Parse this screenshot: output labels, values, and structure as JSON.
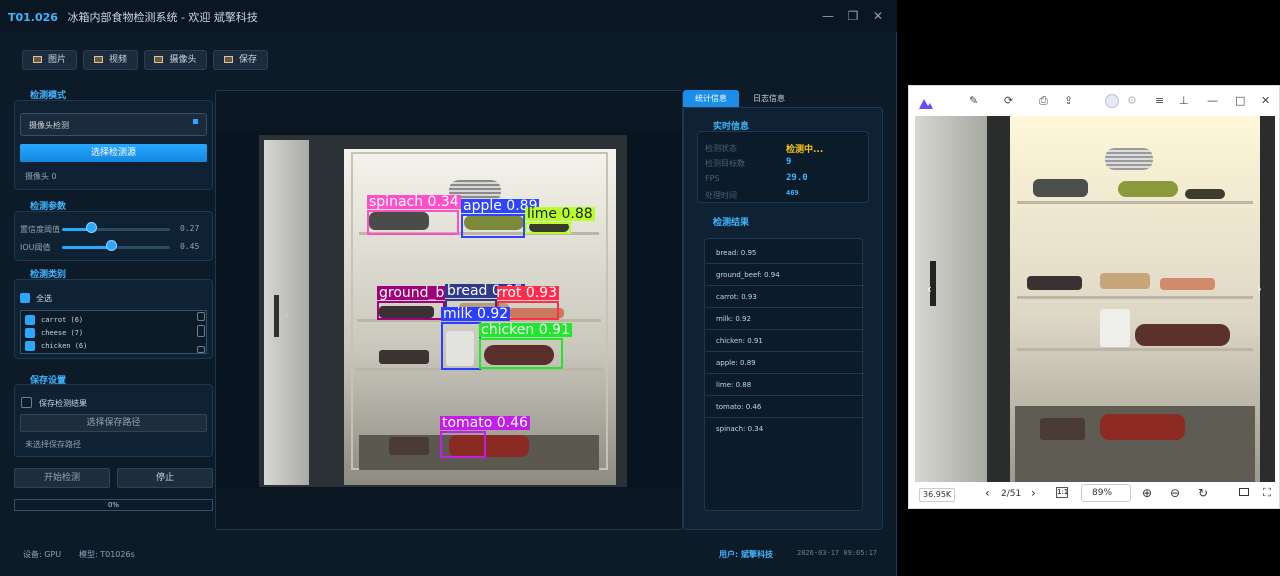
{
  "app": {
    "title_code": "T01.026",
    "title_text": "冰箱内部食物检测系统 - 欢迎 斌擎科技",
    "window_controls": [
      "—",
      "❐",
      "✕"
    ]
  },
  "toolbar": {
    "image_label": "图片",
    "video_label": "视频",
    "camera_label": "摄像头",
    "save_label": "保存"
  },
  "detect_mode": {
    "title": "检测模式",
    "selected_mode": "摄像头检测",
    "select_source_label": "选择检测源",
    "source_status": "摄像头 0"
  },
  "params": {
    "title": "检测参数",
    "conf_label": "置信度阈值",
    "conf_value": "0.27",
    "conf_fraction": 0.27,
    "iou_label": "IOU阈值",
    "iou_value": "0.45",
    "iou_fraction": 0.45
  },
  "classes": {
    "title": "检测类别",
    "select_all_label": "全选",
    "items": [
      "carrot (6)",
      "cheese (7)",
      "chicken (6)"
    ]
  },
  "save_settings": {
    "title": "保存设置",
    "save_result_label": "保存检测结果",
    "choose_path_label": "选择保存路径",
    "path_status": "未选择保存路径"
  },
  "controls": {
    "start_label": "开始检测",
    "stop_label": "停止",
    "progress_text": "0%",
    "progress_fraction": 0.0
  },
  "detections": [
    {
      "label": "spinach 0.34",
      "color": "#ff4fc8"
    },
    {
      "label": "apple 0.89",
      "color": "#2f44ff"
    },
    {
      "label": "lime 0.88",
      "color": "#b7ff2a"
    },
    {
      "label": "ground_beef 0.94",
      "color": "#a0007a"
    },
    {
      "label": "bread 0.95",
      "color": "#2e3a8a"
    },
    {
      "label": "carrot 0.93",
      "color": "#ff2d4b"
    },
    {
      "label": "milk 0.92",
      "color": "#2a3fff"
    },
    {
      "label": "chicken 0.91",
      "color": "#1ee82a"
    },
    {
      "label": "tomato 0.46",
      "color": "#c21ee8"
    }
  ],
  "right_panel": {
    "tab_stats": "统计信息",
    "tab_log": "日志信息",
    "realtime_title": "实时信息",
    "stats": [
      {
        "key": "检测状态",
        "value": "检测中...",
        "color": "#f5c518"
      },
      {
        "key": "检测目标数",
        "value": "9",
        "color": "#3fb6ff"
      },
      {
        "key": "FPS",
        "value": "29.0",
        "color": "#3fb6ff"
      },
      {
        "key": "处理时间",
        "value": "469",
        "color": "#3fb6ff"
      }
    ],
    "results_title": "检测结果",
    "results": [
      "bread: 0.95",
      "ground_beef: 0.94",
      "carrot: 0.93",
      "milk: 0.92",
      "chicken: 0.91",
      "apple: 0.89",
      "lime: 0.88",
      "tomato: 0.46",
      "spinach: 0.34"
    ]
  },
  "status_bar": {
    "device": "设备: GPU",
    "model": "模型: T01026s",
    "user_label": "用户: 斌擎科技",
    "datetime": "2026-03-17 09:05:17"
  },
  "viewer": {
    "file_size": "36.95K",
    "page_indicator": "2/51",
    "zoom": "89%"
  },
  "colors": {
    "accent": "#2aa7ff",
    "background": "#0d1a28"
  }
}
